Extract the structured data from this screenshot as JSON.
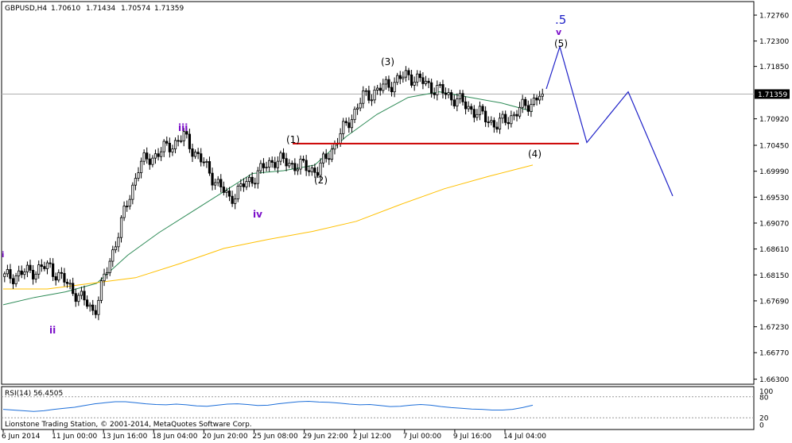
{
  "chart_data": [
    {
      "type": "candlestick",
      "header": {
        "symbol": "GBPUSD,H4",
        "ohlc": [
          "1.70610",
          "1.71434",
          "1.70574",
          "1.71359"
        ]
      },
      "price_axis": {
        "ticks": [
          "1.72760",
          "1.72300",
          "1.71850",
          "1.71359",
          "1.70920",
          "1.70450",
          "1.69990",
          "1.69530",
          "1.69070",
          "1.68610",
          "1.68150",
          "1.67690",
          "1.67230",
          "1.66770",
          "1.66300"
        ],
        "ylim": [
          1.6621,
          1.73
        ],
        "current_price": 1.71359
      },
      "time_axis": {
        "ticks": [
          "6 Jun 2014",
          "11 Jun 00:00",
          "13 Jun 16:00",
          "18 Jun 04:00",
          "20 Jun 20:00",
          "25 Jun 08:00",
          "29 Jun 22:00",
          "2 Jul 12:00",
          "7 Jul 00:00",
          "9 Jul 16:00",
          "14 Jul 04:00"
        ]
      },
      "key_price_path": {
        "x": [
          "6 Jun 2014",
          "9 Jun",
          "10 Jun",
          "16 Jun",
          "18 Jun",
          "23 Jun",
          "25 Jun",
          "26 Jun",
          "30 Jun",
          "3 Jul",
          "8 Jul",
          "11 Jul",
          "14 Jul 04:00"
        ],
        "y": [
          1.681,
          1.683,
          1.675,
          1.701,
          1.706,
          1.695,
          1.702,
          1.7,
          1.713,
          1.717,
          1.713,
          1.708,
          1.7136
        ]
      },
      "series": [
        {
          "name": "",
          "type": "moving-average",
          "color": "#2e8b57",
          "values": [
            1.6762,
            1.6775,
            1.6785,
            1.68,
            1.685,
            1.689,
            1.6925,
            1.696,
            1.6995,
            1.7,
            1.701,
            1.706,
            1.71,
            1.713,
            1.714,
            1.713,
            1.712,
            1.7105
          ]
        },
        {
          "name": "",
          "type": "moving-average",
          "color": "#ffc000",
          "values": [
            1.679,
            1.679,
            1.68,
            1.681,
            1.6835,
            1.6862,
            1.6878,
            1.6892,
            1.691,
            1.694,
            1.6968,
            1.699,
            1.701
          ]
        }
      ],
      "annotations": {
        "support_level": {
          "price": 1.7048,
          "color": "#cc0000"
        },
        "wave_labels": [
          {
            "text": "i",
            "color": "#7b0ec9"
          },
          {
            "text": "ii",
            "color": "#7b0ec9"
          },
          {
            "text": "iii",
            "color": "#7b0ec9"
          },
          {
            "text": "iv",
            "color": "#7b0ec9"
          },
          {
            "text": "v",
            "color": "#7b0ec9"
          },
          {
            "text": ".5",
            "color": "#1f22c8"
          },
          {
            "text": "(1)",
            "color": "#000000"
          },
          {
            "text": "(2)",
            "color": "#000000"
          },
          {
            "text": "(3)",
            "color": "#000000"
          },
          {
            "text": "(4)",
            "color": "#000000"
          },
          {
            "text": "(5)",
            "color": "#000000"
          }
        ],
        "projection": {
          "color": "#1f22c8",
          "y": [
            1.7145,
            1.722,
            1.705,
            1.714,
            1.6955
          ]
        }
      }
    },
    {
      "type": "line",
      "indicator": "RSI(14) 56.4505",
      "ylim": [
        0,
        100
      ],
      "levels": [
        "100",
        "80",
        "20",
        "0"
      ],
      "color": "#1e6fd9",
      "values": [
        44,
        42,
        40,
        38,
        40,
        44,
        47,
        50,
        55,
        60,
        63,
        66,
        66,
        63,
        60,
        58,
        57,
        59,
        57,
        54,
        53,
        56,
        59,
        60,
        58,
        55,
        56,
        60,
        63,
        66,
        67,
        65,
        64,
        62,
        59,
        57,
        58,
        55,
        52,
        53,
        56,
        58,
        56,
        52,
        49,
        47,
        45,
        44,
        42,
        42,
        44,
        49,
        56
      ]
    }
  ],
  "footer": {
    "copyright": "Lionstone Trading Station, © 2001-2014, MetaQuotes Software Corp."
  }
}
